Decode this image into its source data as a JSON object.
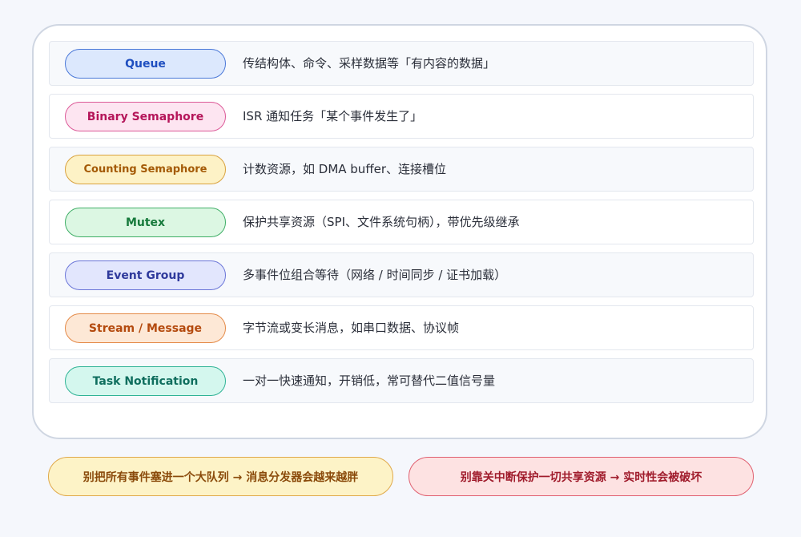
{
  "rows": [
    {
      "name": "Queue",
      "desc": "传结构体、命令、采样数据等「有内容的数据」",
      "bg": "#dce8fd",
      "border": "#4a78d8",
      "color": "#1f4fc0"
    },
    {
      "name": "Binary Semaphore",
      "desc": "ISR 通知任务「某个事件发生了」",
      "bg": "#fde5f1",
      "border": "#dc5a98",
      "color": "#b5165a"
    },
    {
      "name": "Counting Semaphore",
      "desc": "计数资源，如 DMA buffer、连接槽位",
      "bg": "#fdf2c6",
      "border": "#d9a23e",
      "color": "#a45a06"
    },
    {
      "name": "Mutex",
      "desc": "保护共享资源（SPI、文件系统句柄），带优先级继承",
      "bg": "#dcf7e3",
      "border": "#3fae66",
      "color": "#177a3c"
    },
    {
      "name": "Event Group",
      "desc": "多事件位组合等待（网络 / 时间同步 / 证书加载）",
      "bg": "#e2e6fd",
      "border": "#6b76d8",
      "color": "#2f3a9c"
    },
    {
      "name": "Stream / Message",
      "desc": "字节流或变长消息，如串口数据、协议帧",
      "bg": "#fde8d6",
      "border": "#e48a48",
      "color": "#b44a0e"
    },
    {
      "name": "Task Notification",
      "desc": "一对一快速通知，开销低，常可替代二值信号量",
      "bg": "#d4f7ee",
      "border": "#2fb396",
      "color": "#0f6e5e"
    }
  ],
  "warnings": {
    "left": "别把所有事件塞进一个大队列 → 消息分发器会越来越胖",
    "right": "别靠关中断保护一切共享资源 → 实时性会被破坏"
  }
}
